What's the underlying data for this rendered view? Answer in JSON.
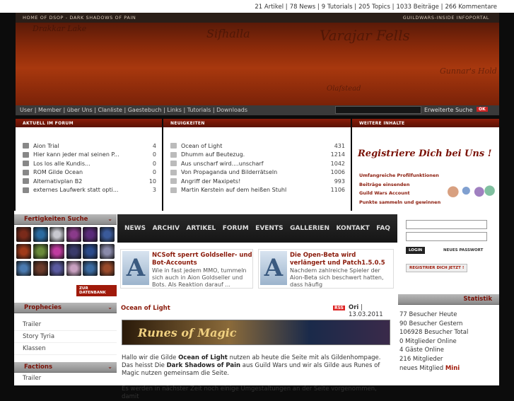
{
  "stats": {
    "artikel": "21 Artikel",
    "news": "78 News",
    "tutorials": "9 Tutorials",
    "topics": "205 Topics",
    "beitraege": "1033 Beiträge",
    "kommentare": "266 Kommentare"
  },
  "topstrip": {
    "left": "HOME OF DSOP - DARK SHADOWS OF PAIN",
    "right": "GUILDWARS-INSIDE INFOPORTAL"
  },
  "banner": {
    "words": [
      "Sifhalla",
      "Varajar Fells",
      "Drakkar Lake",
      "Gunnar's Hold",
      "Olafstead"
    ]
  },
  "nav": {
    "items": [
      "User",
      "Member",
      "über Uns",
      "Clanliste",
      "Gaestebuch",
      "Links",
      "Tutorials",
      "Downloads"
    ],
    "sep": " | ",
    "adv": "Erweiterte Suche",
    "ok": "OK"
  },
  "forum": {
    "title": "AKTUELL IM FORUM",
    "rows": [
      {
        "t": "Aion Trial",
        "n": "4"
      },
      {
        "t": "Hier kann jeder mal seinen P...",
        "n": "0"
      },
      {
        "t": "Los los alle Kundis...",
        "n": "0"
      },
      {
        "t": "ROM Gilde Ocean",
        "n": "0"
      },
      {
        "t": "Alternativplan B2",
        "n": "10"
      },
      {
        "t": "externes Laufwerk statt opti...",
        "n": "3"
      }
    ]
  },
  "neu": {
    "title": "NEUIGKEITEN",
    "rows": [
      {
        "t": "Ocean of Light",
        "n": "431"
      },
      {
        "t": "Dhumm auf Beutezug.",
        "n": "1214"
      },
      {
        "t": "Aus unscharf wird....unscharf",
        "n": "1042"
      },
      {
        "t": "Von Propaganda und Bilderrätseln",
        "n": "1006"
      },
      {
        "t": "Angriff der Maxipets!",
        "n": "993"
      },
      {
        "t": "Martin Kerstein auf dem heißen Stuhl",
        "n": "1106"
      }
    ]
  },
  "weitere": {
    "title": "WEITERE INHALTE",
    "headline": "Registriere Dich bei Uns !",
    "items": [
      "Umfangreiche Profilfunktionen",
      "Beiträge einsenden",
      "Guild Wars Account",
      "Punkte sammeln und gewinnen"
    ]
  },
  "skills": {
    "title": "Fertigkeiten Suche",
    "btn": "ZUR DATENBANK",
    "colors": [
      "#7a2a1a",
      "#2a6aa0",
      "#c8c8d0",
      "#8a3a8a",
      "#5a2a7a",
      "#3a5a9a",
      "#a03a1a",
      "#6a8a3a",
      "#c03aa0",
      "#3a3a6a",
      "#2a4a8a",
      "#8a8aaa",
      "#4a7ab0",
      "#6a3a2a",
      "#5a5aa0",
      "#c8a0c0",
      "#3a6aa0",
      "#9a4a2a"
    ]
  },
  "prophecies": {
    "title": "Prophecies",
    "links": [
      "Trailer",
      "Story Tyria",
      "Klassen"
    ]
  },
  "factions": {
    "title": "Factions",
    "links": [
      "Trailer"
    ]
  },
  "mainnav": [
    "NEWS",
    "ARCHIV",
    "ARTIKEL",
    "FORUM",
    "EVENTS",
    "GALLERIEN",
    "KONTAKT",
    "FAQ"
  ],
  "news1": {
    "logo": "A",
    "title": "NCSoft sperrt Goldseller- und Bot-Accounts",
    "text": "Wie in fast jedem MMO, tummeln sich auch in Aion Goldseller und Bots. Als Reaktion darauf ..."
  },
  "news2": {
    "logo": "A",
    "title": "Die Open-Beta wird verlängert und Patch1.5.0.5",
    "text": "Nachdem zahlreiche Spieler der Aion-Beta sich beschwert hatten, dass häufig"
  },
  "article": {
    "title": "Ocean of Light",
    "rss": "RSS",
    "author": "Ori",
    "date": "13.03.2011",
    "meta_sep": " | ",
    "banner": "Runes of Magic",
    "p1a": "Hallo wir die Gilde ",
    "p1b": "Ocean of Light",
    "p1c": " nutzen ab heute die Seite mit als Gildenhompage. Das heisst Die ",
    "p1d": "Dark Shadows of Pain",
    "p1e": " aus Guild Wars und wir als Gilde aus Runes of Magic nutzen gemeinsam die Seite.",
    "p2": "Es werden in nächster Zeit noch einige Umgestaltungen an der Seite vorgenommen, damit"
  },
  "login": {
    "login": "LOGIN",
    "newpw": "NEUES PASSWORT",
    "register": "REGISTRIER DICH JETZT !"
  },
  "statistik": {
    "title": "Statistik",
    "lines": [
      "77 Besucher Heute",
      "90 Besucher Gestern",
      "106928 Besucher Total",
      "0 Mitglieder Online",
      "4 Gäste Online",
      "216 Mitglieder"
    ],
    "newmember_label": "neues Mitglied ",
    "newmember": "Mini"
  }
}
